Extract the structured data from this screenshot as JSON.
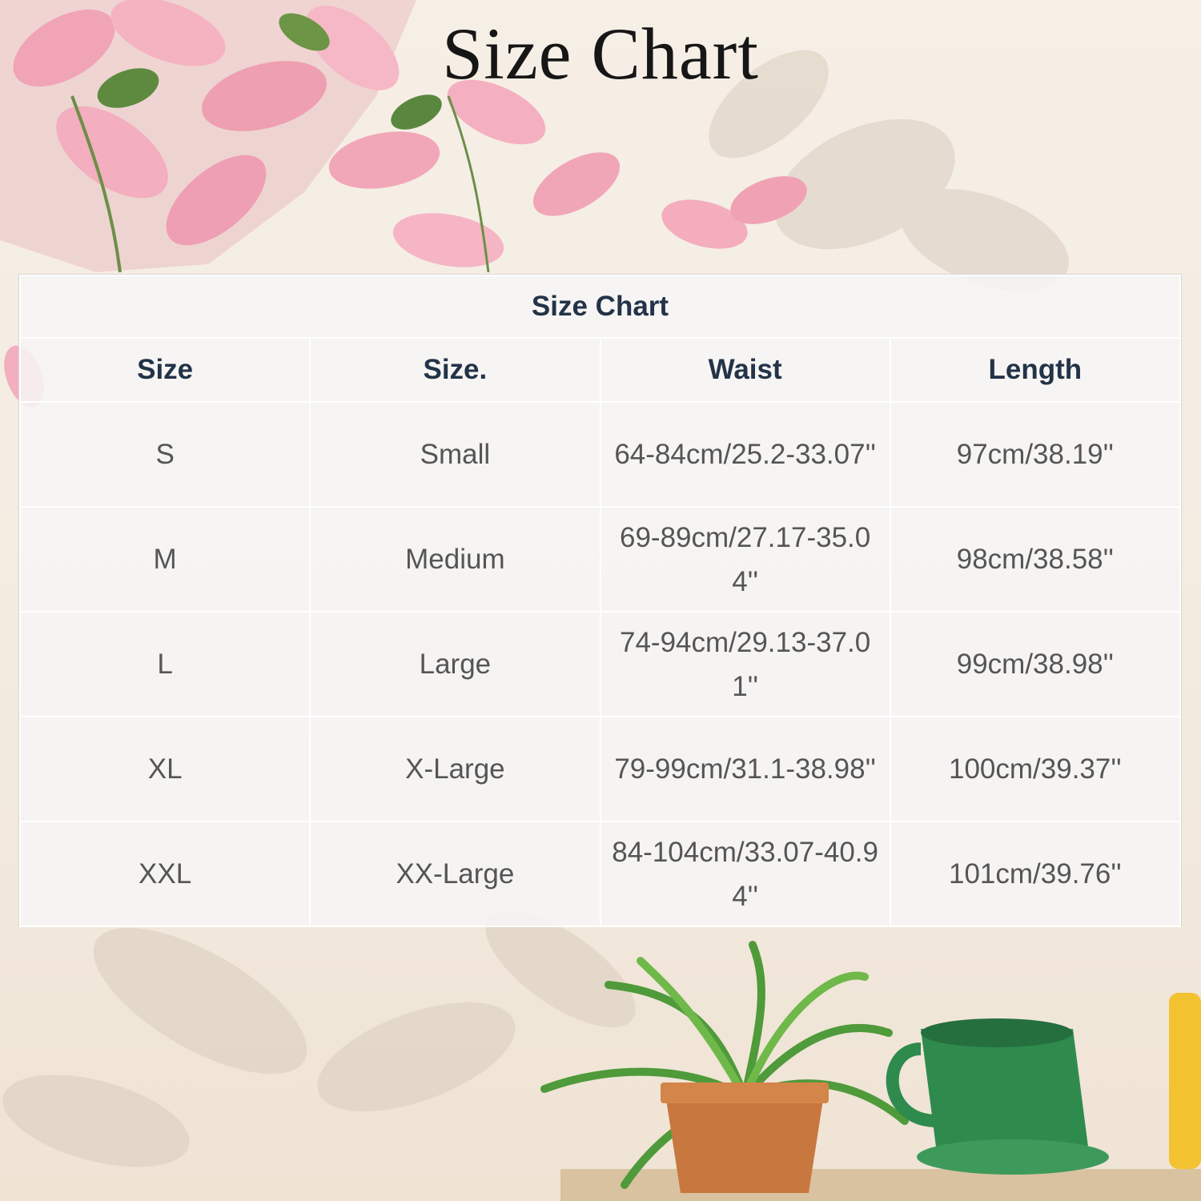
{
  "page": {
    "title": "Size Chart"
  },
  "table": {
    "caption": "Size Chart",
    "columns": [
      "Size",
      "Size.",
      "Waist",
      "Length"
    ],
    "rows": [
      [
        "S",
        "Small",
        "64-84cm/25.2-33.07''",
        "97cm/38.19''"
      ],
      [
        "M",
        "Medium",
        "69-89cm/27.17-35.04''",
        "98cm/38.58''"
      ],
      [
        "L",
        "Large",
        "74-94cm/29.13-37.01''",
        "99cm/38.98''"
      ],
      [
        "XL",
        "X-Large",
        "79-99cm/31.1-38.98''",
        "100cm/39.37''"
      ],
      [
        "XXL",
        "XX-Large",
        "84-104cm/33.07-40.94''",
        "101cm/39.76''"
      ]
    ]
  },
  "colors": {
    "title_text": "#161616",
    "header_text": "#233348",
    "cell_text": "#555555",
    "leaf_pink": "#f2a9b8",
    "fern_green": "#4f9a3a",
    "mug_green": "#2f8a4e",
    "pot_terracotta": "#c8773e"
  }
}
